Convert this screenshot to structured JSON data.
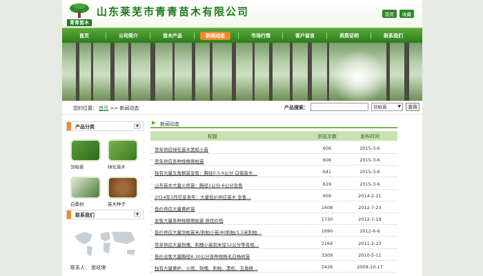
{
  "brand": {
    "company": "山东莱芜市青青苗木有限公司",
    "logo_text": "青青苗木"
  },
  "toplinks": [
    "首页",
    "收藏"
  ],
  "nav": [
    {
      "label": "首页",
      "active": false
    },
    {
      "label": "公司简介",
      "active": false
    },
    {
      "label": "苗木产品",
      "active": false
    },
    {
      "label": "新闻动态",
      "active": true
    },
    {
      "label": "市场行情",
      "active": false
    },
    {
      "label": "客户留言",
      "active": false
    },
    {
      "label": "资质证明",
      "active": false
    },
    {
      "label": "联系我们",
      "active": false
    }
  ],
  "breadcrumb": {
    "prefix": "您的位置：",
    "home": "首页",
    "sep": ">>",
    "current": "新闻动态"
  },
  "search": {
    "label": "产品搜索：",
    "value": "",
    "select": "剑柏苗",
    "button": "查询"
  },
  "sidebar": {
    "products_title": "产品分类",
    "products": [
      {
        "label": "剑柏苗"
      },
      {
        "label": "绿化苗木"
      },
      {
        "label": "白桑树"
      },
      {
        "label": "苗木种子"
      }
    ],
    "contact_title": "联系我们",
    "contact_line": "联系人：  苗经理"
  },
  "main": {
    "section_title": "新闻动态",
    "columns": {
      "title": "标题",
      "views": "浏览次数",
      "date": "发布时间"
    },
    "rows": [
      {
        "title": "常年供应绿化苗木黑松小苗",
        "views": "606",
        "date": "2015-3-6"
      },
      {
        "title": "常年供应各种规格侧柏苗",
        "views": "606",
        "date": "2015-3-6"
      },
      {
        "title": "独有大量五角枫苗急售：胸径0.5-6公分 白蜡苗木…",
        "views": "641",
        "date": "2015-3-6"
      },
      {
        "title": "山东苗木大量火炬苗：胸径1公分-6公分急售",
        "views": "619",
        "date": "2015-3-6"
      },
      {
        "title": "2014年3月信息发布：大量低价供应苗木 急售…",
        "views": "956",
        "date": "2014-2-21"
      },
      {
        "title": "低价供应大量黄栌苗",
        "views": "1608",
        "date": "2012-7-23"
      },
      {
        "title": "急售大量各种规格侧柏苗 质优价低",
        "views": "1730",
        "date": "2012-7-18"
      },
      {
        "title": "低价供应大量剑柏苗米/刺柏小苗/80刺柏/1.5米刺柏…",
        "views": "1690",
        "date": "2012-6-6"
      },
      {
        "title": "常年供应大量刺槐、刺槐小苗到米径12公分等各规…",
        "views": "2164",
        "date": "2011-2-23"
      },
      {
        "title": "低价出售大量胸径8-30公分各种规格毛白杨树苗",
        "views": "3309",
        "date": "2010-5-11"
      },
      {
        "title": "独有大量黄栌、火炬、刺槐、刺柏、黑松、五角枫…",
        "views": "2426",
        "date": "2009-10-17"
      }
    ]
  },
  "colors": {
    "nav_green": "#2d7d1c",
    "active_orange": "#f08a2a",
    "brand_green": "#1f7a1f",
    "table_head": "#c9e2b4"
  }
}
